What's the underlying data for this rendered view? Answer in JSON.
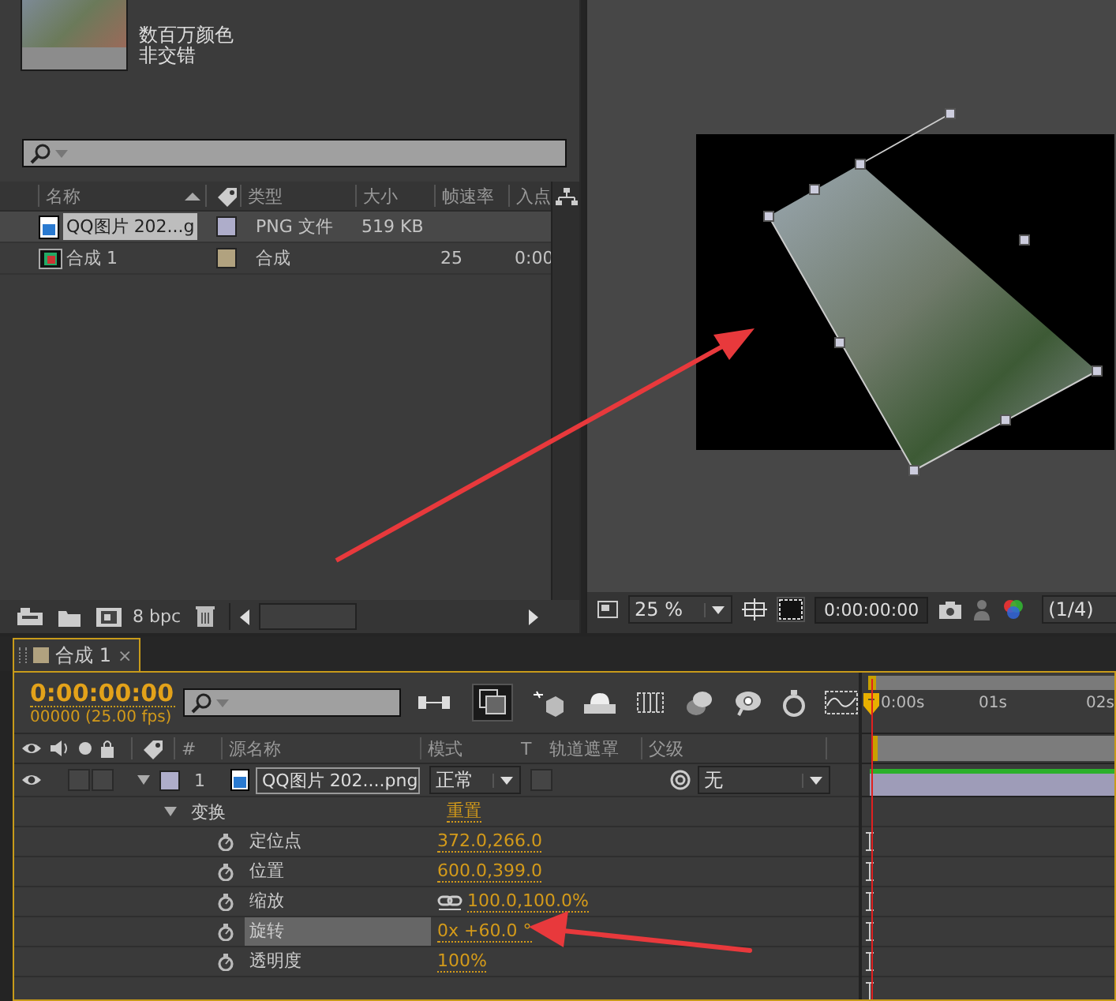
{
  "project": {
    "info": [
      "数百万颜色",
      "非交错"
    ],
    "columns": [
      "名称",
      "类型",
      "大小",
      "帧速率",
      "入点"
    ],
    "rows": [
      {
        "kind": "footage",
        "name": "QQ图片 202...g",
        "color": "#aeadca",
        "type": "PNG 文件",
        "size": "519 KB",
        "selected": true
      },
      {
        "kind": "composition",
        "name": "合成 1",
        "color": "#b1a27f",
        "type": "合成",
        "frame_rate": "25",
        "in_point": "0:00",
        "selected": false
      }
    ],
    "footer": {
      "depth": "8 bpc"
    }
  },
  "viewer": {
    "zoom": "25 %",
    "timecode": "0:00:00:00",
    "resolution": "(1/4)"
  },
  "timeline": {
    "tab": {
      "label": "合成 1",
      "close": "×",
      "color": "#b1a27f",
      "selected": true
    },
    "timecode": "0:00:00:00",
    "frame_info": "00000 (25.00 fps)",
    "columns": [
      "#",
      "源名称",
      "模式",
      "T",
      "轨道遮罩",
      "父级"
    ],
    "ruler": [
      "0:00s",
      "01s",
      "02s"
    ],
    "layers": [
      {
        "index": "1",
        "name": "QQ图片 202....png",
        "color": "#aeadca",
        "mode": "正常",
        "parent": "无",
        "visible": true,
        "expanded": true,
        "groups": [
          {
            "name": "变换",
            "action": "重置",
            "expanded": true,
            "properties": [
              {
                "kind": "value",
                "name": "定位点",
                "value": "372.0,266.0",
                "selected": false
              },
              {
                "kind": "value",
                "name": "位置",
                "value": "600.0,399.0",
                "selected": false
              },
              {
                "kind": "linked",
                "name": "缩放",
                "value": "100.0,100.0%",
                "selected": false
              },
              {
                "kind": "value",
                "name": "旋转",
                "value": "0x +60.0 °",
                "selected": true
              },
              {
                "kind": "value",
                "name": "透明度",
                "value": "100%",
                "selected": false
              }
            ]
          }
        ]
      }
    ]
  }
}
